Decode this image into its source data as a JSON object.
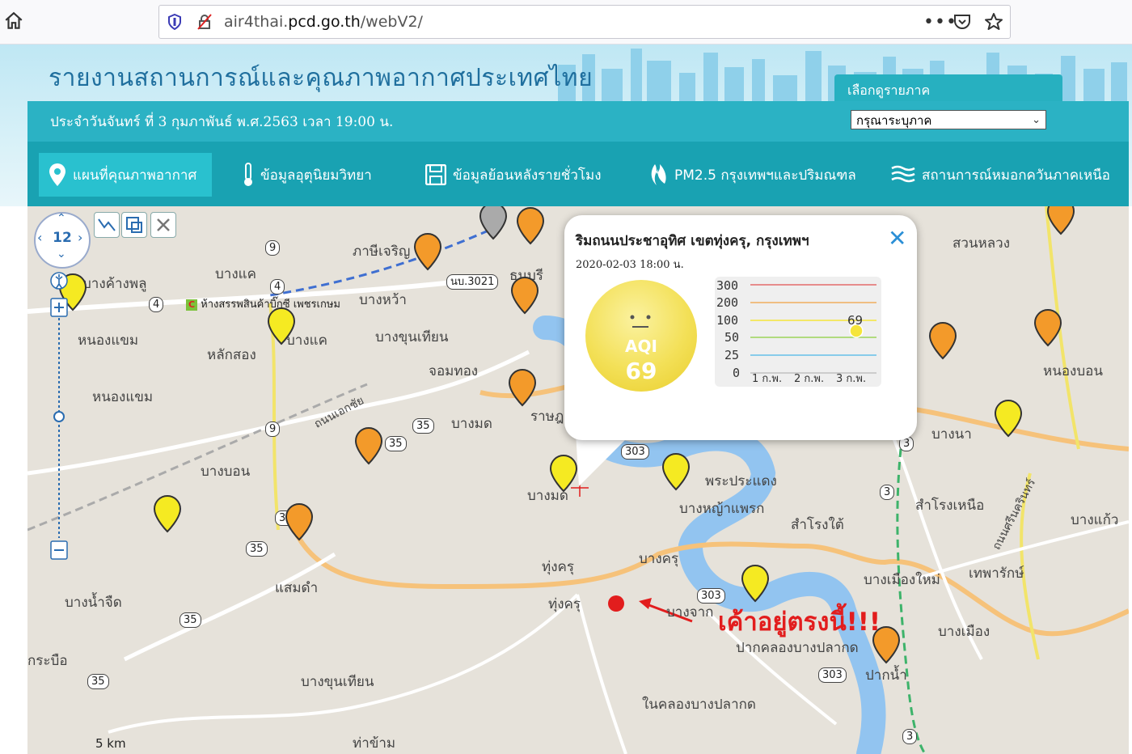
{
  "browser": {
    "url_prefix": "air4thai.",
    "url_host": "pcd.go.th",
    "url_path": "/webV2/",
    "menu_dots": "•••"
  },
  "header": {
    "title": "รายงานสถานการณ์และคุณภาพอากาศประเทศไทย",
    "date_line": "ประจำวันจันทร์ ที่ 3 กุมภาพันธ์ พ.ศ.2563 เวลา 19:00 น.",
    "region_label": "เลือกดูรายภาค",
    "region_select": "กรุณาระบุภาค"
  },
  "nav": [
    {
      "label": "แผนที่คุณภาพอากาศ",
      "icon": "map-pin-icon"
    },
    {
      "label": "ข้อมูลอุตุนิยมวิทยา",
      "icon": "thermometer-icon"
    },
    {
      "label": "ข้อมูลย้อนหลังรายชั่วโมง",
      "icon": "save-icon"
    },
    {
      "label": "PM2.5 กรุงเทพฯและปริมณฑล",
      "icon": "flame-icon"
    },
    {
      "label": "สถานการณ์หมอกควันภาคเหนือ",
      "icon": "haze-icon"
    }
  ],
  "map": {
    "zoom_level": "12",
    "scale": "5 km",
    "places": [
      "หนองแขม",
      "หลักสอง",
      "บางแค",
      "ภาษีเจริญ",
      "บางหว้า",
      "บางขุนเทียน",
      "จอมทอง",
      "บางมด",
      "บางบอน",
      "แสมดำ",
      "บางน้ำจืด",
      "กระบือ",
      "บางขุนเทียน",
      "ทุ่งครุ",
      "ทุ่งครุ",
      "บางมด",
      "พระประแดง",
      "บางหญ้าแพรก",
      "สำโรงใต้",
      "บางครุ",
      "บางจาก",
      "ปากคลองบางปลากด",
      "ปากน้ำ",
      "ในคลองบางปลากด",
      "บางเมืองใหม่",
      "บางเมือง",
      "เทพารักษ์",
      "สำโรงเหนือ",
      "บางแก้ว",
      "บางนา",
      "สวนหลวง",
      "หนองบอน",
      "ท่าข้าม",
      "บางค้างพลู",
      "บางแค",
      "ราษฎ",
      "ธนบุรี",
      "ถนนเอกชัย",
      "ถนนศรีนครินทร์",
      "หนองแขม"
    ],
    "poi": "ห้างสรรพสินค้าบิ๊กซี เพชรเกษม",
    "route_shields": [
      "9",
      "4",
      "4",
      "9",
      "35",
      "35",
      "35",
      "35",
      "35",
      "35",
      "303",
      "303",
      "303",
      "3",
      "3",
      "3",
      "นบ.3021"
    ]
  },
  "popup": {
    "title": "ริมถนนประชาอุทิศ เขตทุ่งครุ, กรุงเทพฯ",
    "datetime": "2020-02-03 18:00 น.",
    "aqi_label": "AQI",
    "aqi_value": "69",
    "chart_y_ticks": [
      "300",
      "200",
      "100",
      "50",
      "25",
      "0"
    ],
    "chart_x_ticks": [
      "1 ก.พ.",
      "2 ก.พ.",
      "3 ก.พ."
    ],
    "chart_point_label": "69"
  },
  "annotation": "เค้าอยู่ตรงนี้!!!",
  "colors": {
    "nav_bg": "#19a2b2",
    "strip_bg": "#2bb2c4",
    "pin_orange": "#f39a2a",
    "pin_yellow": "#f5ea22",
    "annotation": "#e21d1d"
  }
}
